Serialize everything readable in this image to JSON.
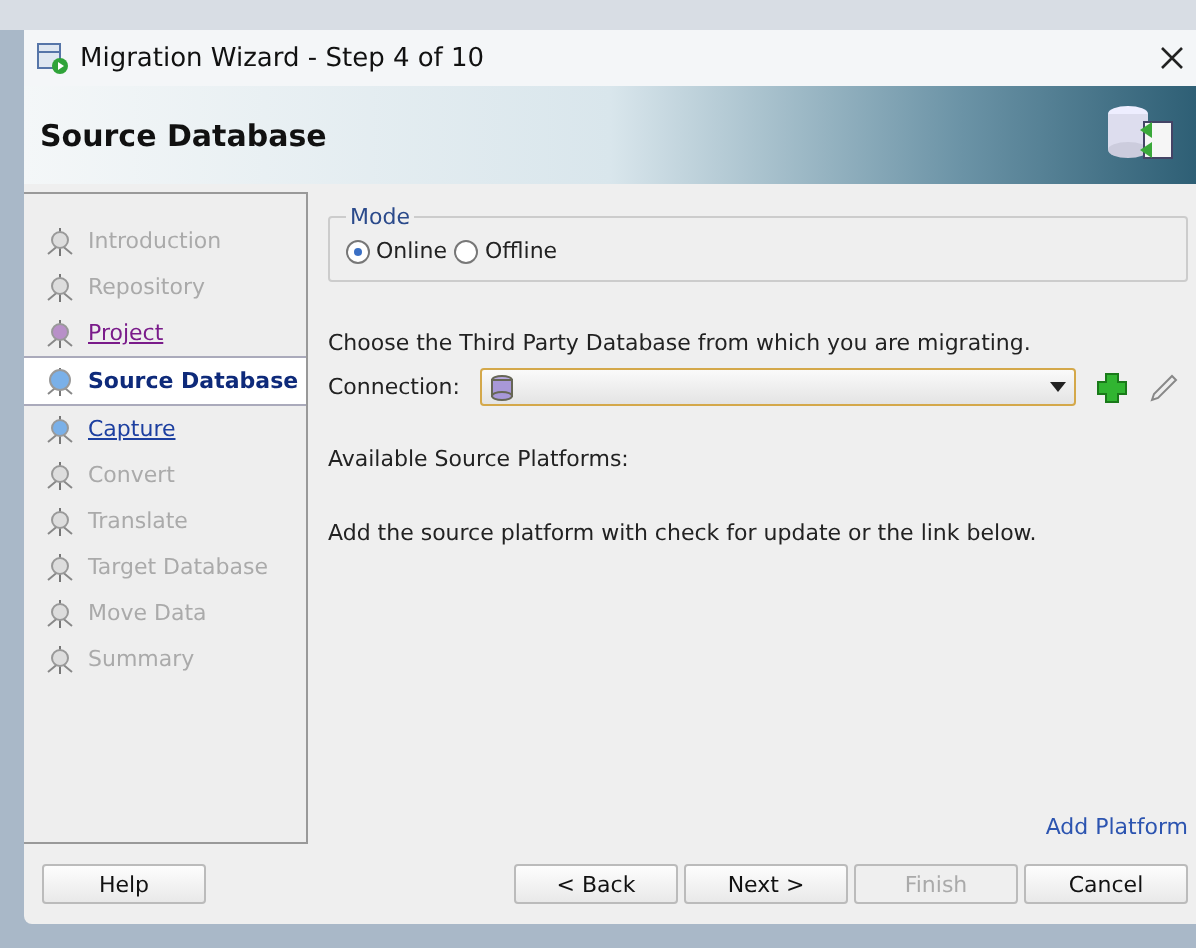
{
  "window": {
    "title": "Migration Wizard - Step 4 of 10"
  },
  "header": {
    "title": "Source Database"
  },
  "steps": [
    {
      "label": "Introduction",
      "kind": "disabled"
    },
    {
      "label": "Repository",
      "kind": "disabled"
    },
    {
      "label": "Project",
      "kind": "visited"
    },
    {
      "label": "Source Database",
      "kind": "current"
    },
    {
      "label": "Capture",
      "kind": "link"
    },
    {
      "label": "Convert",
      "kind": "disabled"
    },
    {
      "label": "Translate",
      "kind": "disabled"
    },
    {
      "label": "Target Database",
      "kind": "disabled"
    },
    {
      "label": "Move Data",
      "kind": "disabled"
    },
    {
      "label": "Summary",
      "kind": "disabled"
    }
  ],
  "mode": {
    "legend": "Mode",
    "options": [
      {
        "label": "Online",
        "selected": true
      },
      {
        "label": "Offline",
        "selected": false
      }
    ]
  },
  "prompt": "Choose the Third Party Database from which you are migrating.",
  "connection": {
    "label": "Connection:"
  },
  "platforms_label": "Available Source Platforms:",
  "hint": "Add the source platform with check for update or the link below.",
  "add_platform": "Add Platform",
  "buttons": [
    {
      "label": "Help",
      "disabled": false
    },
    {
      "label": "< Back",
      "disabled": false
    },
    {
      "label": "Next >",
      "disabled": false
    },
    {
      "label": "Finish",
      "disabled": true
    },
    {
      "label": "Cancel",
      "disabled": false
    }
  ]
}
